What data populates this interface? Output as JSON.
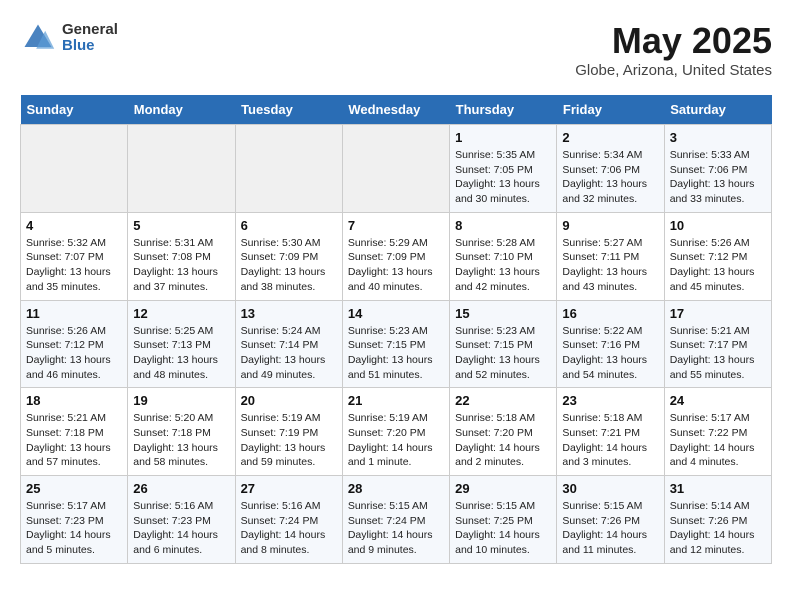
{
  "logo": {
    "general": "General",
    "blue": "Blue"
  },
  "header": {
    "title": "May 2025",
    "subtitle": "Globe, Arizona, United States"
  },
  "days_of_week": [
    "Sunday",
    "Monday",
    "Tuesday",
    "Wednesday",
    "Thursday",
    "Friday",
    "Saturday"
  ],
  "weeks": [
    [
      {
        "day": "",
        "detail": ""
      },
      {
        "day": "",
        "detail": ""
      },
      {
        "day": "",
        "detail": ""
      },
      {
        "day": "",
        "detail": ""
      },
      {
        "day": "1",
        "detail": "Sunrise: 5:35 AM\nSunset: 7:05 PM\nDaylight: 13 hours\nand 30 minutes."
      },
      {
        "day": "2",
        "detail": "Sunrise: 5:34 AM\nSunset: 7:06 PM\nDaylight: 13 hours\nand 32 minutes."
      },
      {
        "day": "3",
        "detail": "Sunrise: 5:33 AM\nSunset: 7:06 PM\nDaylight: 13 hours\nand 33 minutes."
      }
    ],
    [
      {
        "day": "4",
        "detail": "Sunrise: 5:32 AM\nSunset: 7:07 PM\nDaylight: 13 hours\nand 35 minutes."
      },
      {
        "day": "5",
        "detail": "Sunrise: 5:31 AM\nSunset: 7:08 PM\nDaylight: 13 hours\nand 37 minutes."
      },
      {
        "day": "6",
        "detail": "Sunrise: 5:30 AM\nSunset: 7:09 PM\nDaylight: 13 hours\nand 38 minutes."
      },
      {
        "day": "7",
        "detail": "Sunrise: 5:29 AM\nSunset: 7:09 PM\nDaylight: 13 hours\nand 40 minutes."
      },
      {
        "day": "8",
        "detail": "Sunrise: 5:28 AM\nSunset: 7:10 PM\nDaylight: 13 hours\nand 42 minutes."
      },
      {
        "day": "9",
        "detail": "Sunrise: 5:27 AM\nSunset: 7:11 PM\nDaylight: 13 hours\nand 43 minutes."
      },
      {
        "day": "10",
        "detail": "Sunrise: 5:26 AM\nSunset: 7:12 PM\nDaylight: 13 hours\nand 45 minutes."
      }
    ],
    [
      {
        "day": "11",
        "detail": "Sunrise: 5:26 AM\nSunset: 7:12 PM\nDaylight: 13 hours\nand 46 minutes."
      },
      {
        "day": "12",
        "detail": "Sunrise: 5:25 AM\nSunset: 7:13 PM\nDaylight: 13 hours\nand 48 minutes."
      },
      {
        "day": "13",
        "detail": "Sunrise: 5:24 AM\nSunset: 7:14 PM\nDaylight: 13 hours\nand 49 minutes."
      },
      {
        "day": "14",
        "detail": "Sunrise: 5:23 AM\nSunset: 7:15 PM\nDaylight: 13 hours\nand 51 minutes."
      },
      {
        "day": "15",
        "detail": "Sunrise: 5:23 AM\nSunset: 7:15 PM\nDaylight: 13 hours\nand 52 minutes."
      },
      {
        "day": "16",
        "detail": "Sunrise: 5:22 AM\nSunset: 7:16 PM\nDaylight: 13 hours\nand 54 minutes."
      },
      {
        "day": "17",
        "detail": "Sunrise: 5:21 AM\nSunset: 7:17 PM\nDaylight: 13 hours\nand 55 minutes."
      }
    ],
    [
      {
        "day": "18",
        "detail": "Sunrise: 5:21 AM\nSunset: 7:18 PM\nDaylight: 13 hours\nand 57 minutes."
      },
      {
        "day": "19",
        "detail": "Sunrise: 5:20 AM\nSunset: 7:18 PM\nDaylight: 13 hours\nand 58 minutes."
      },
      {
        "day": "20",
        "detail": "Sunrise: 5:19 AM\nSunset: 7:19 PM\nDaylight: 13 hours\nand 59 minutes."
      },
      {
        "day": "21",
        "detail": "Sunrise: 5:19 AM\nSunset: 7:20 PM\nDaylight: 14 hours\nand 1 minute."
      },
      {
        "day": "22",
        "detail": "Sunrise: 5:18 AM\nSunset: 7:20 PM\nDaylight: 14 hours\nand 2 minutes."
      },
      {
        "day": "23",
        "detail": "Sunrise: 5:18 AM\nSunset: 7:21 PM\nDaylight: 14 hours\nand 3 minutes."
      },
      {
        "day": "24",
        "detail": "Sunrise: 5:17 AM\nSunset: 7:22 PM\nDaylight: 14 hours\nand 4 minutes."
      }
    ],
    [
      {
        "day": "25",
        "detail": "Sunrise: 5:17 AM\nSunset: 7:23 PM\nDaylight: 14 hours\nand 5 minutes."
      },
      {
        "day": "26",
        "detail": "Sunrise: 5:16 AM\nSunset: 7:23 PM\nDaylight: 14 hours\nand 6 minutes."
      },
      {
        "day": "27",
        "detail": "Sunrise: 5:16 AM\nSunset: 7:24 PM\nDaylight: 14 hours\nand 8 minutes."
      },
      {
        "day": "28",
        "detail": "Sunrise: 5:15 AM\nSunset: 7:24 PM\nDaylight: 14 hours\nand 9 minutes."
      },
      {
        "day": "29",
        "detail": "Sunrise: 5:15 AM\nSunset: 7:25 PM\nDaylight: 14 hours\nand 10 minutes."
      },
      {
        "day": "30",
        "detail": "Sunrise: 5:15 AM\nSunset: 7:26 PM\nDaylight: 14 hours\nand 11 minutes."
      },
      {
        "day": "31",
        "detail": "Sunrise: 5:14 AM\nSunset: 7:26 PM\nDaylight: 14 hours\nand 12 minutes."
      }
    ]
  ]
}
